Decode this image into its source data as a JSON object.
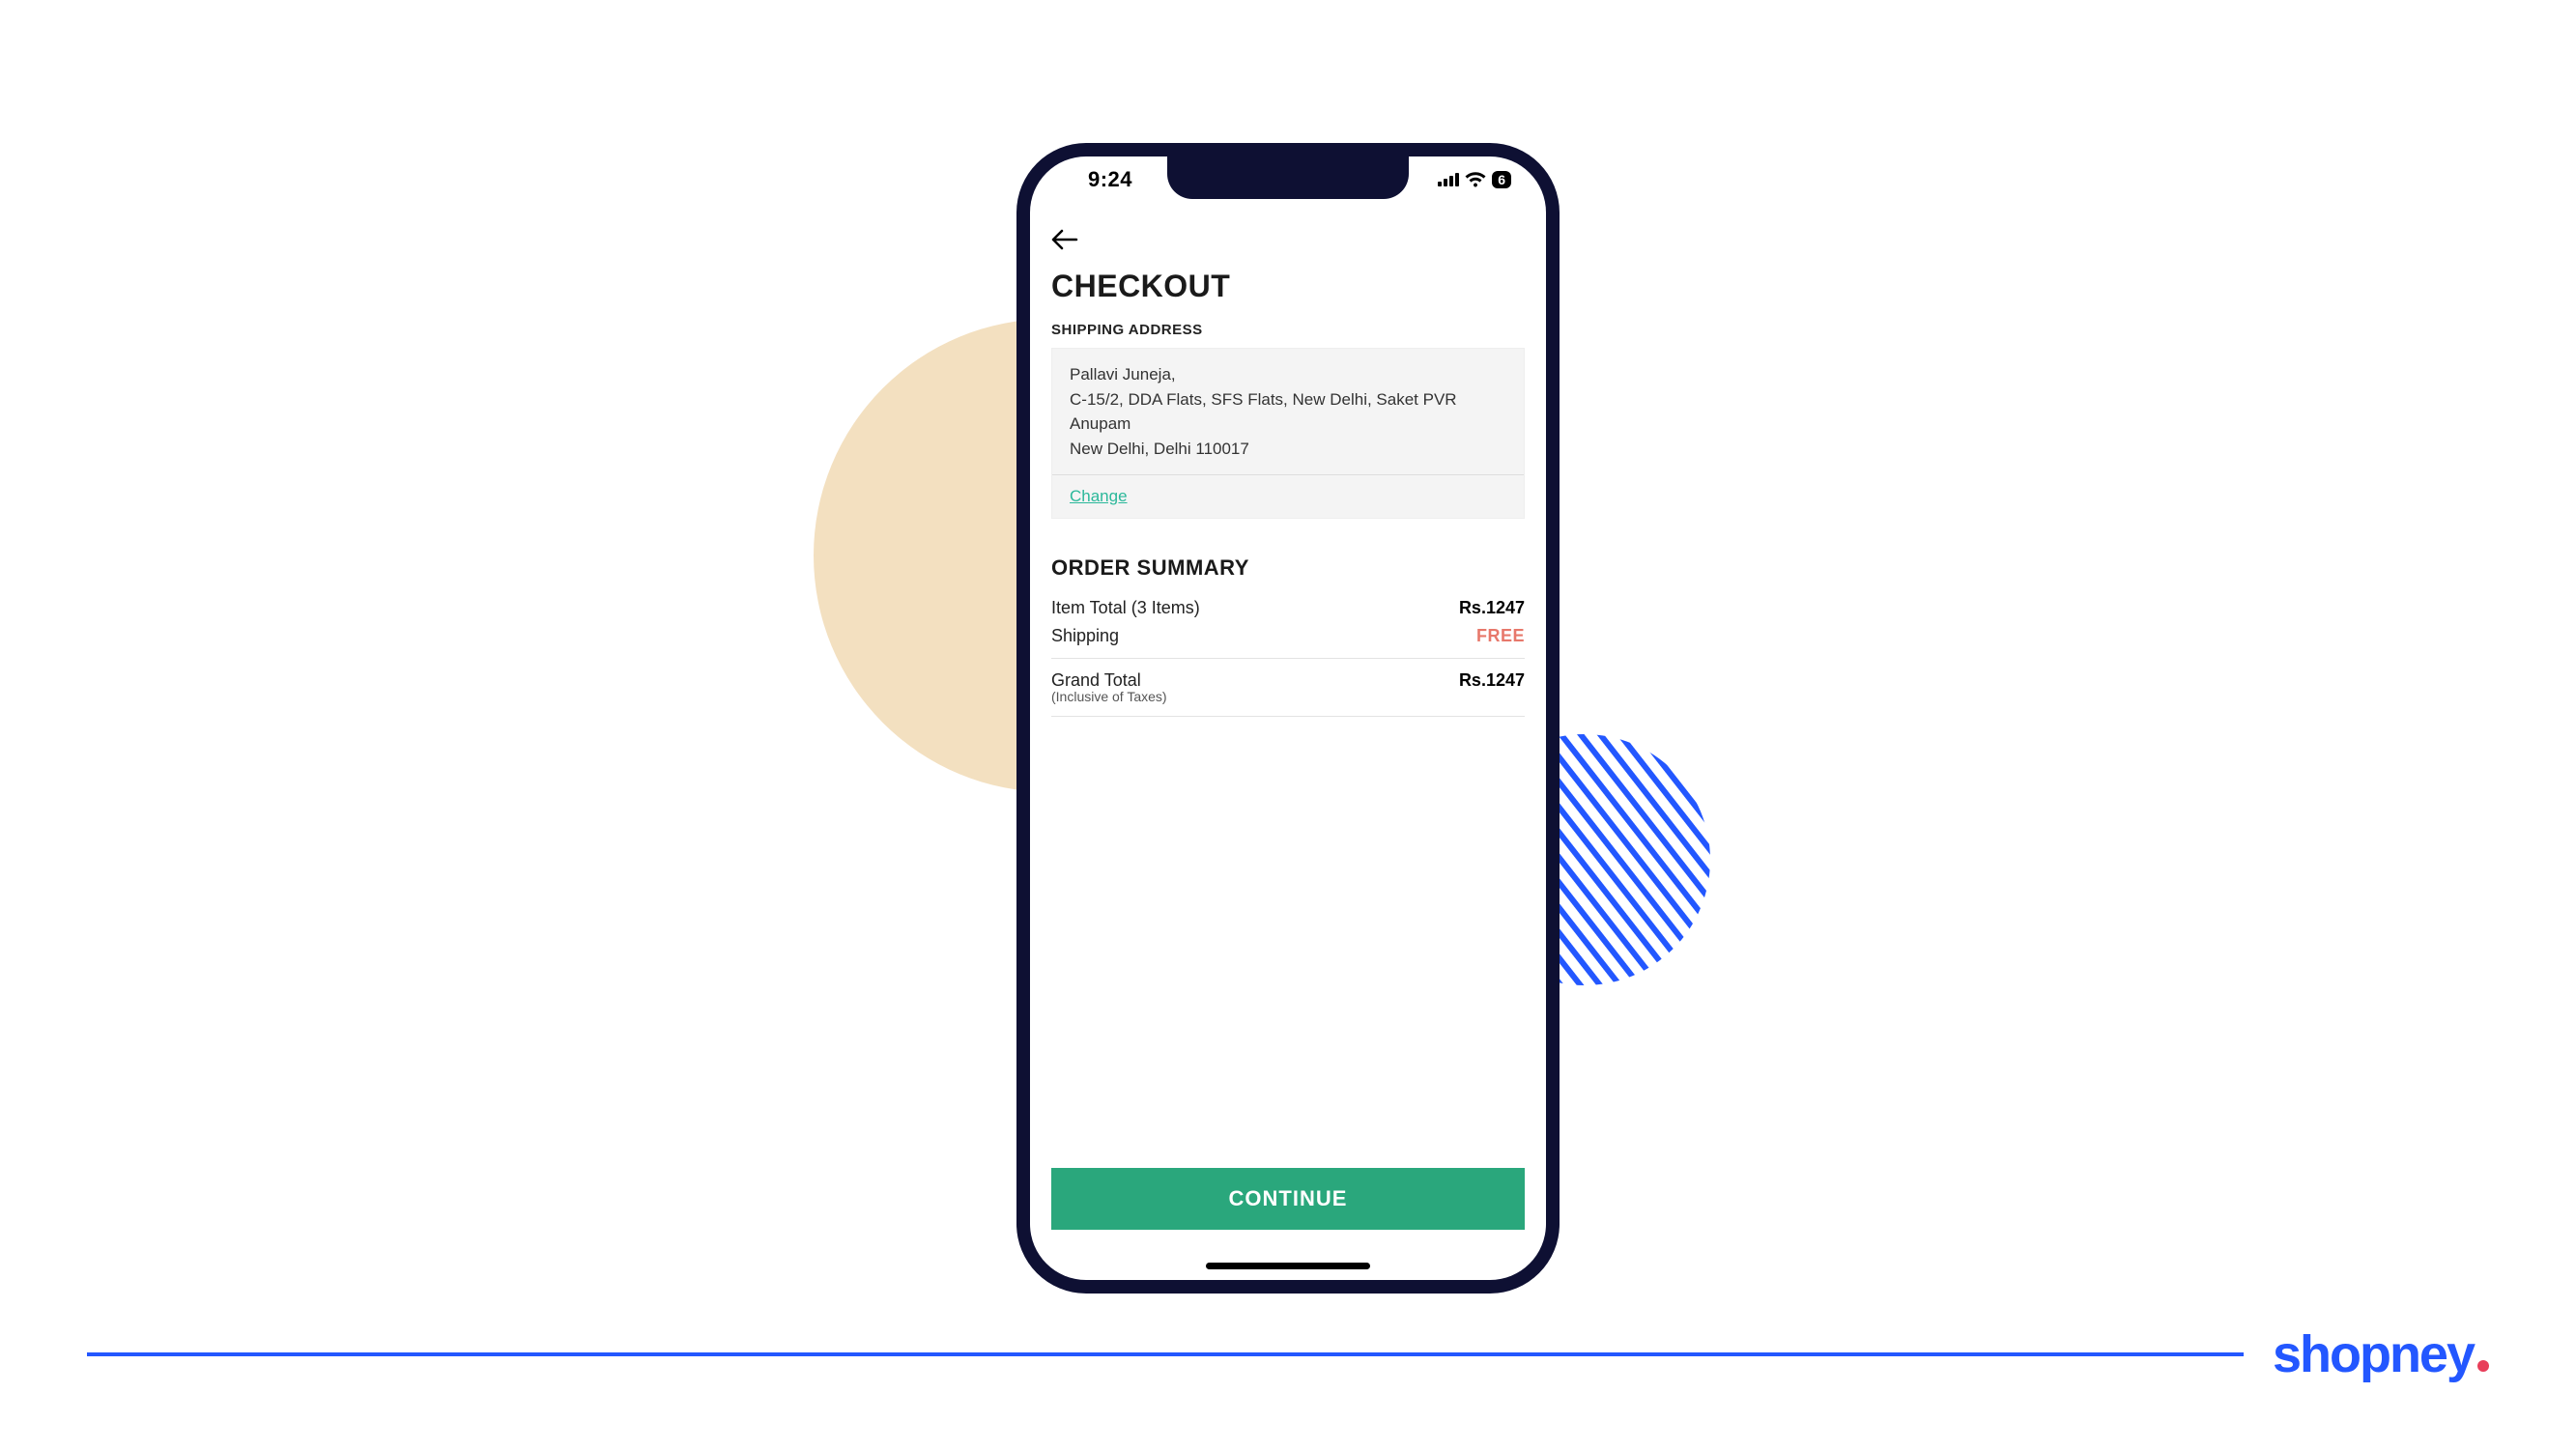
{
  "status": {
    "time": "9:24",
    "battery_text": "6"
  },
  "page": {
    "title": "CHECKOUT",
    "shipping_label": "SHIPPING ADDRESS",
    "address": {
      "line1": "Pallavi Juneja,",
      "line2": "C-15/2, DDA Flats, SFS Flats, New Delhi, Saket PVR Anupam",
      "line3": "New Delhi, Delhi 110017"
    },
    "change_label": "Change",
    "summary_title": "ORDER SUMMARY",
    "rows": {
      "item_total_label": "Item Total (3 Items)",
      "item_total_value": "Rs.1247",
      "shipping_label": "Shipping",
      "shipping_value": "FREE",
      "grand_total_label": "Grand Total",
      "grand_total_sub": "(Inclusive of Taxes)",
      "grand_total_value": "Rs.1247"
    },
    "cta": "CONTINUE"
  },
  "brand": {
    "name": "shopney"
  }
}
